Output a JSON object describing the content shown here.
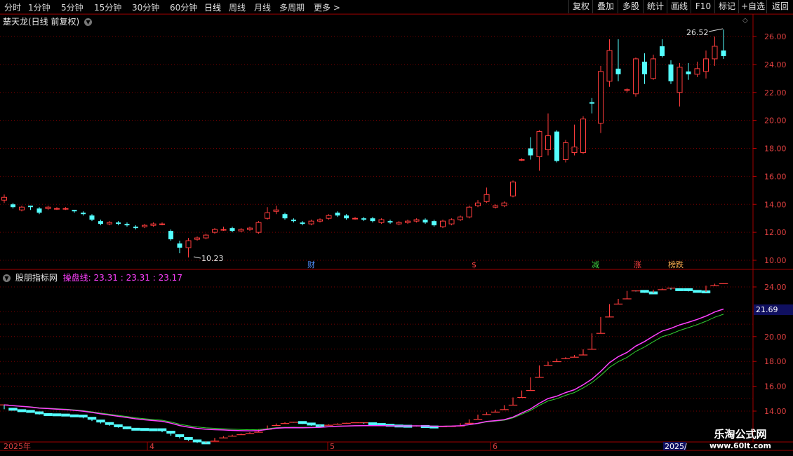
{
  "toolbar": {
    "tabs": [
      "分时",
      "1分钟",
      "5分钟",
      "15分钟",
      "30分钟",
      "60分钟",
      "日线",
      "周线",
      "月线",
      "多周期",
      "更多 >"
    ],
    "active_tab": "日线",
    "right_buttons": [
      "复权",
      "叠加",
      "多股",
      "统计",
      "画线",
      "F10",
      "标记",
      "+自选",
      "返回"
    ]
  },
  "main_panel": {
    "title": "楚天龙(日线 前复权)",
    "y_ticks": [
      "26.00",
      "24.00",
      "22.00",
      "20.00",
      "18.00",
      "16.00",
      "14.00",
      "12.00",
      "10.00"
    ],
    "high_label": "26.52",
    "low_label": "10.23",
    "markers": [
      "财",
      "$",
      "减",
      "涨",
      "榜跌"
    ]
  },
  "indicator_panel": {
    "title": "股朋指标网",
    "line_name": "操盘线:",
    "values": "23.31 : 23.31 : 23.17",
    "y_ticks": [
      "24.00",
      "20.00",
      "18.00",
      "16.00",
      "14.00"
    ],
    "current_value": "21.69"
  },
  "date_axis": [
    "2025年",
    "4",
    "5",
    "6",
    "2025/"
  ],
  "watermark": {
    "line1": "乐淘公式网",
    "line2": "www.60lt.com"
  },
  "colors": {
    "up": "#ff3c3c",
    "down": "#54ffff",
    "grid": "#7a0000",
    "magenta": "#ff40ff",
    "green": "#30d030"
  },
  "candles": [
    [
      14.3,
      14.5,
      14.7,
      14.1
    ],
    [
      14.0,
      13.8,
      14.1,
      13.7
    ],
    [
      13.6,
      13.8,
      13.9,
      13.5
    ],
    [
      13.9,
      13.8,
      13.9,
      13.6
    ],
    [
      13.7,
      13.4,
      13.8,
      13.3
    ],
    [
      13.7,
      13.8,
      13.9,
      13.6
    ],
    [
      13.7,
      13.7,
      13.8,
      13.6
    ],
    [
      13.7,
      13.7,
      13.8,
      13.6
    ],
    [
      13.6,
      13.5,
      13.6,
      13.4
    ],
    [
      13.4,
      13.3,
      13.5,
      13.2
    ],
    [
      13.2,
      12.9,
      13.3,
      12.8
    ],
    [
      12.8,
      12.6,
      12.9,
      12.5
    ],
    [
      12.6,
      12.7,
      12.8,
      12.5
    ],
    [
      12.7,
      12.6,
      12.8,
      12.5
    ],
    [
      12.6,
      12.5,
      12.7,
      12.4
    ],
    [
      12.4,
      12.3,
      12.5,
      12.2
    ],
    [
      12.4,
      12.5,
      12.6,
      12.3
    ],
    [
      12.5,
      12.6,
      12.7,
      12.4
    ],
    [
      12.6,
      12.6,
      12.7,
      12.5
    ],
    [
      12.1,
      11.5,
      12.2,
      11.4
    ],
    [
      11.2,
      10.9,
      11.4,
      10.5
    ],
    [
      10.9,
      11.4,
      11.6,
      10.2
    ],
    [
      11.5,
      11.6,
      11.7,
      11.4
    ],
    [
      11.6,
      11.8,
      11.9,
      11.5
    ],
    [
      12.0,
      12.2,
      12.3,
      11.9
    ],
    [
      12.2,
      12.2,
      12.4,
      12.1
    ],
    [
      12.3,
      12.1,
      12.4,
      12.0
    ],
    [
      12.1,
      12.2,
      12.3,
      12.0
    ],
    [
      12.2,
      12.3,
      12.4,
      12.1
    ],
    [
      12.0,
      12.7,
      12.8,
      11.9
    ],
    [
      13.0,
      13.4,
      13.8,
      12.9
    ],
    [
      13.5,
      13.6,
      13.9,
      13.3
    ],
    [
      13.3,
      13.0,
      13.4,
      12.9
    ],
    [
      12.9,
      12.8,
      13.0,
      12.7
    ],
    [
      12.7,
      12.6,
      12.8,
      12.5
    ],
    [
      12.6,
      12.8,
      12.9,
      12.5
    ],
    [
      12.8,
      12.9,
      13.0,
      12.7
    ],
    [
      13.0,
      13.2,
      13.3,
      12.9
    ],
    [
      13.4,
      13.2,
      13.5,
      13.1
    ],
    [
      13.2,
      13.0,
      13.3,
      12.9
    ],
    [
      13.0,
      13.0,
      13.1,
      12.9
    ],
    [
      13.0,
      12.9,
      13.1,
      12.8
    ],
    [
      13.0,
      12.8,
      13.1,
      12.7
    ],
    [
      12.7,
      12.9,
      13.0,
      12.6
    ],
    [
      12.8,
      12.7,
      12.9,
      12.6
    ],
    [
      12.6,
      12.7,
      12.8,
      12.5
    ],
    [
      12.7,
      12.8,
      12.9,
      12.6
    ],
    [
      12.8,
      12.9,
      13.0,
      12.7
    ],
    [
      12.9,
      12.7,
      13.0,
      12.6
    ],
    [
      12.8,
      12.5,
      12.9,
      12.4
    ],
    [
      12.4,
      12.8,
      12.9,
      12.3
    ],
    [
      12.6,
      12.9,
      13.0,
      12.5
    ],
    [
      12.9,
      13.1,
      13.2,
      12.8
    ],
    [
      13.1,
      13.8,
      13.9,
      13.0
    ],
    [
      13.9,
      14.1,
      14.3,
      13.8
    ],
    [
      14.2,
      14.7,
      15.2,
      14.1
    ],
    [
      13.8,
      13.9,
      14.0,
      13.7
    ],
    [
      13.9,
      14.1,
      14.2,
      13.8
    ],
    [
      14.6,
      15.6,
      15.7,
      14.5
    ],
    [
      17.2,
      17.2,
      17.3,
      17.1
    ],
    [
      18.0,
      17.5,
      18.8,
      17.2
    ],
    [
      17.4,
      19.2,
      19.3,
      16.4
    ],
    [
      17.9,
      18.9,
      20.5,
      17.5
    ],
    [
      19.2,
      17.1,
      19.3,
      17.0
    ],
    [
      17.2,
      18.4,
      18.6,
      17.0
    ],
    [
      17.7,
      18.1,
      19.7,
      17.5
    ],
    [
      17.7,
      20.1,
      20.3,
      17.6
    ],
    [
      21.3,
      21.2,
      21.6,
      20.5
    ],
    [
      19.8,
      23.5,
      23.9,
      19.1
    ],
    [
      22.8,
      25.0,
      25.8,
      22.4
    ],
    [
      23.7,
      23.3,
      25.8,
      22.8
    ],
    [
      22.2,
      22.2,
      22.3,
      22.0
    ],
    [
      21.9,
      24.4,
      24.5,
      21.7
    ],
    [
      24.2,
      23.3,
      24.8,
      22.6
    ],
    [
      23.0,
      24.4,
      24.7,
      22.9
    ],
    [
      25.3,
      24.6,
      25.8,
      24.5
    ],
    [
      24.0,
      22.8,
      24.3,
      22.6
    ],
    [
      22.0,
      23.8,
      24.1,
      21.0
    ],
    [
      23.5,
      23.3,
      24.1,
      22.9
    ],
    [
      23.3,
      23.7,
      24.2,
      23.1
    ],
    [
      23.5,
      24.4,
      25.0,
      23.0
    ],
    [
      24.4,
      25.3,
      26.0,
      23.9
    ],
    [
      25.0,
      24.6,
      26.5,
      24.4
    ]
  ]
}
